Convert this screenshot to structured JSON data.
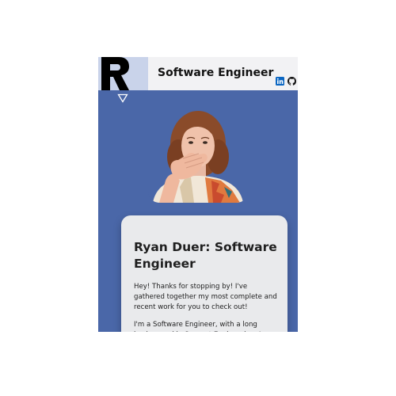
{
  "header": {
    "logo_letter": "R",
    "title": "Software Engineer"
  },
  "icons": {
    "logo": "r-logo-icon",
    "linkedin": "linkedin-icon",
    "github": "github-icon",
    "menu": "triangle-down-icon"
  },
  "hero": {
    "image_alt": "profile-photo"
  },
  "intro": {
    "heading": "Ryan Duer: Software Engineer",
    "paragraph_1": "Hey! Thanks for stopping by! I've gathered together my most complete and recent work for you to check out!",
    "paragraph_2": "I'm a Software Engineer, with a long background in Support Engineering. I"
  },
  "colors": {
    "page_background": "#4a67a8",
    "header_background": "#f2f2f4",
    "logo_background": "#c9d3ea",
    "card_background": "#e9eaec",
    "linkedin_blue": "#0a66c2"
  }
}
